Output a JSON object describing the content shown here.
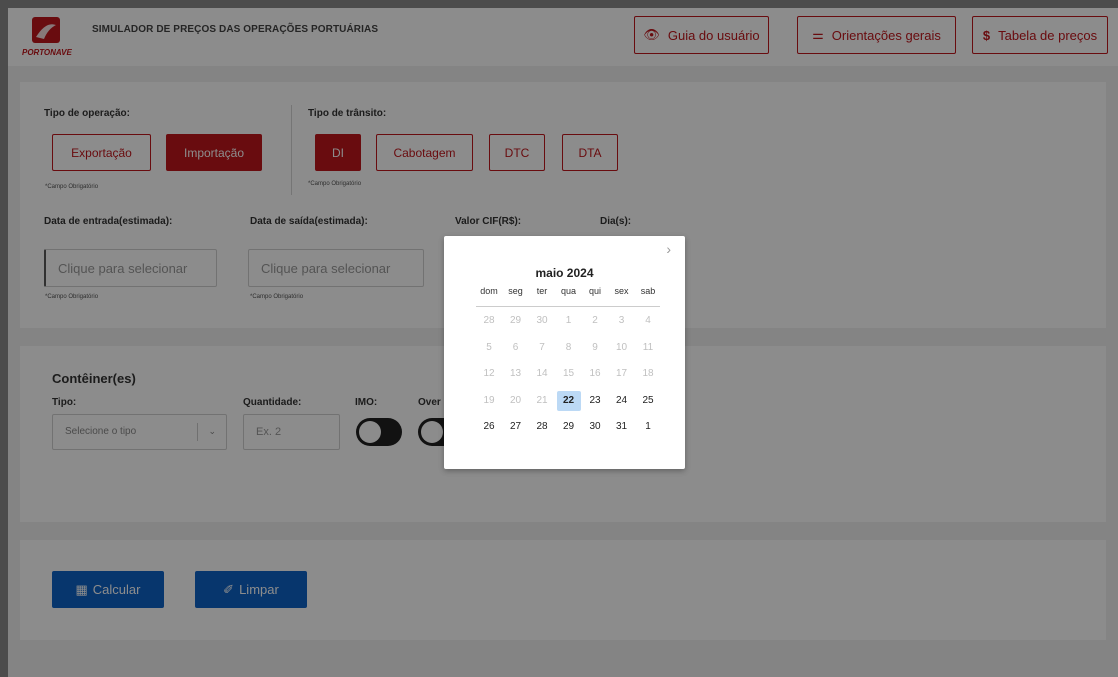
{
  "header": {
    "logo_text": "PORTONAVE",
    "title": "SIMULADOR DE PREÇOS DAS OPERAÇÕES PORTUÁRIAS",
    "buttons": [
      {
        "label": "Guia do usuário",
        "icon": "eye-icon"
      },
      {
        "label": "Orientações gerais",
        "icon": "directions-icon"
      },
      {
        "label": "Tabela de preços",
        "icon": "dollar-icon"
      }
    ]
  },
  "operation": {
    "label": "Tipo de operação:",
    "options": [
      "Exportação",
      "Importação"
    ],
    "selected": "Importação",
    "required": "*Campo Obrigatório"
  },
  "transit": {
    "label": "Tipo de trânsito:",
    "options": [
      "DI",
      "Cabotagem",
      "DTC",
      "DTA"
    ],
    "selected": "DI",
    "required": "*Campo Obrigatório"
  },
  "dates": {
    "entry_label": "Data de entrada(estimada):",
    "entry_placeholder": "Clique para selecionar",
    "exit_label": "Data de saída(estimada):",
    "exit_placeholder": "Clique para selecionar",
    "cif_label": "Valor CIF(R$):",
    "days_label": "Dia(s):",
    "required": "*Campo Obrigatório"
  },
  "containers": {
    "title": "Contêiner(es)",
    "type_label": "Tipo:",
    "type_placeholder": "Selecione o tipo",
    "quantity_label": "Quantidade:",
    "quantity_placeholder": "Ex. 2",
    "imo_label": "IMO:",
    "over_label": "Over"
  },
  "actions": {
    "calculate": "Calcular",
    "clear": "Limpar"
  },
  "datepicker": {
    "month": "maio 2024",
    "weekdays": [
      "dom",
      "seg",
      "ter",
      "qua",
      "qui",
      "sex",
      "sab"
    ],
    "weeks": [
      [
        "28",
        "29",
        "30",
        "1",
        "2",
        "3",
        "4"
      ],
      [
        "5",
        "6",
        "7",
        "8",
        "9",
        "10",
        "11"
      ],
      [
        "12",
        "13",
        "14",
        "15",
        "16",
        "17",
        "18"
      ],
      [
        "19",
        "20",
        "21",
        "22",
        "23",
        "24",
        "25"
      ],
      [
        "26",
        "27",
        "28",
        "29",
        "30",
        "31",
        "1"
      ]
    ],
    "today": "22",
    "next_icon": "chevron-right-icon"
  },
  "colors": {
    "brand": "#c0161c",
    "action": "#0d63c7",
    "today_highlight": "#bcd9f5"
  }
}
